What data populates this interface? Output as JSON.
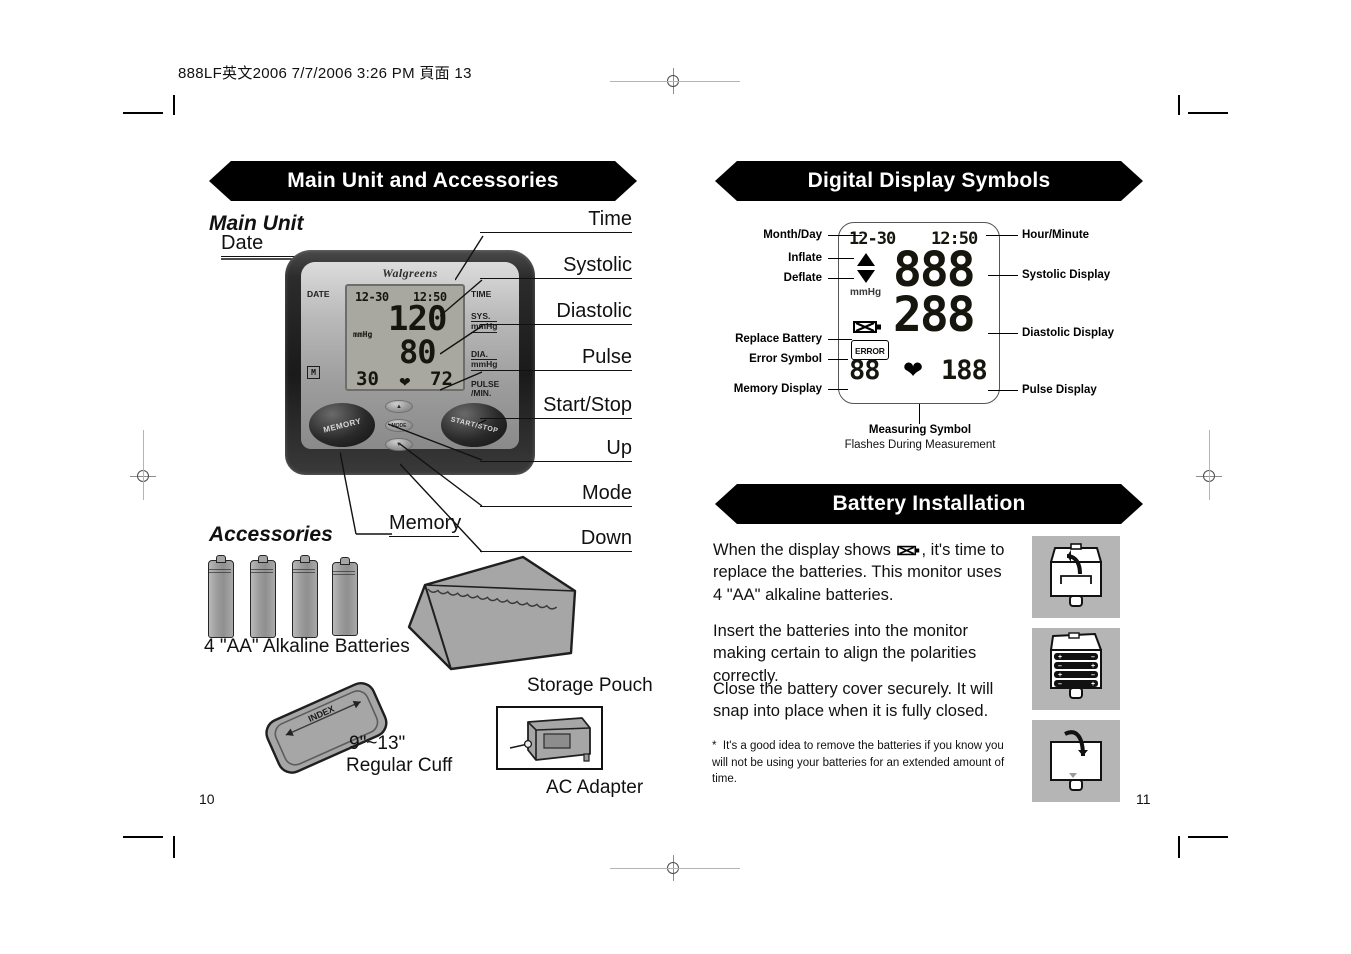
{
  "document": {
    "header_line": "888LF英文2006  7/7/2006  3:26 PM  頁面 13",
    "left_page_number": "10",
    "right_page_number": "11"
  },
  "left_page": {
    "banner_title": "Main Unit and Accessories",
    "main_unit_heading": "Main Unit",
    "accessories_heading": "Accessories",
    "callouts_left": [
      {
        "label": "Date"
      },
      {
        "label": "Memory"
      }
    ],
    "callouts_right": [
      {
        "label": "Time"
      },
      {
        "label": "Systolic"
      },
      {
        "label": "Diastolic"
      },
      {
        "label": "Pulse"
      },
      {
        "label": "Start/Stop"
      },
      {
        "label": "Up"
      },
      {
        "label": "Mode"
      },
      {
        "label": "Down"
      }
    ],
    "device": {
      "brand": "Walgreens",
      "label_date": "DATE",
      "label_time": "TIME",
      "label_sys": "SYS.",
      "label_sys_unit": "mmHg",
      "label_dia": "DIA.",
      "label_dia_unit": "mmHg",
      "label_pulse": "PULSE",
      "label_pulse_unit": "/MIN.",
      "lcd_date": "12-30",
      "lcd_time": "12:50",
      "lcd_mmhg": "mmHg",
      "lcd_memory_icon": "M",
      "lcd_systolic": "120",
      "lcd_diastolic": "80",
      "lcd_memory_number": "30",
      "lcd_pulse": "72",
      "button_memory": "MEMORY",
      "button_start_stop": "START/STOP",
      "button_mode": "MODE",
      "button_up": "▲",
      "button_down": "▼"
    },
    "accessories": {
      "batteries_caption": "4 \"AA\" Alkaline Batteries",
      "pouch_caption": "Storage Pouch",
      "cuff_caption_line1": "9\"~13\"",
      "cuff_caption_line2": "Regular Cuff",
      "cuff_index_label": "INDEX",
      "adapter_caption": "AC Adapter"
    }
  },
  "right_page": {
    "banner_symbols": "Digital Display Symbols",
    "banner_battery": "Battery Installation",
    "symbols_left": [
      {
        "label": "Month/Day"
      },
      {
        "label": "Inflate"
      },
      {
        "label": "Deflate"
      },
      {
        "label": "Replace Battery"
      },
      {
        "label": "Error Symbol"
      },
      {
        "label": "Memory Display"
      }
    ],
    "symbols_right": [
      {
        "label": "Hour/Minute"
      },
      {
        "label": "Systolic Display"
      },
      {
        "label": "Diastolic Display"
      },
      {
        "label": "Pulse Display"
      }
    ],
    "measuring_symbol_title": "Measuring Symbol",
    "measuring_symbol_sub": "Flashes During Measurement",
    "lcd": {
      "date": "12-30",
      "time": "12:50",
      "mmhg": "mmHg",
      "error_text": "ERROR",
      "systolic": "888",
      "diastolic": "288",
      "memory": "88",
      "pulse": "188"
    },
    "battery_text": {
      "p1_before_icon": "When the display shows ",
      "p1_after_icon": ", it's time to replace the batteries. This monitor uses 4 \"AA\" alkaline batteries.",
      "p2": "Insert the batteries into the monitor making certain to align the polarities correctly.",
      "p3": "Close the battery cover securely. It will snap into place when it is fully closed.",
      "footnote_marker": "*",
      "footnote": "It's a good idea to remove the batteries if you know you will not be using your batteries for an extended amount of  time."
    },
    "battery_diagram": {
      "plus": "+",
      "minus": "–"
    }
  }
}
